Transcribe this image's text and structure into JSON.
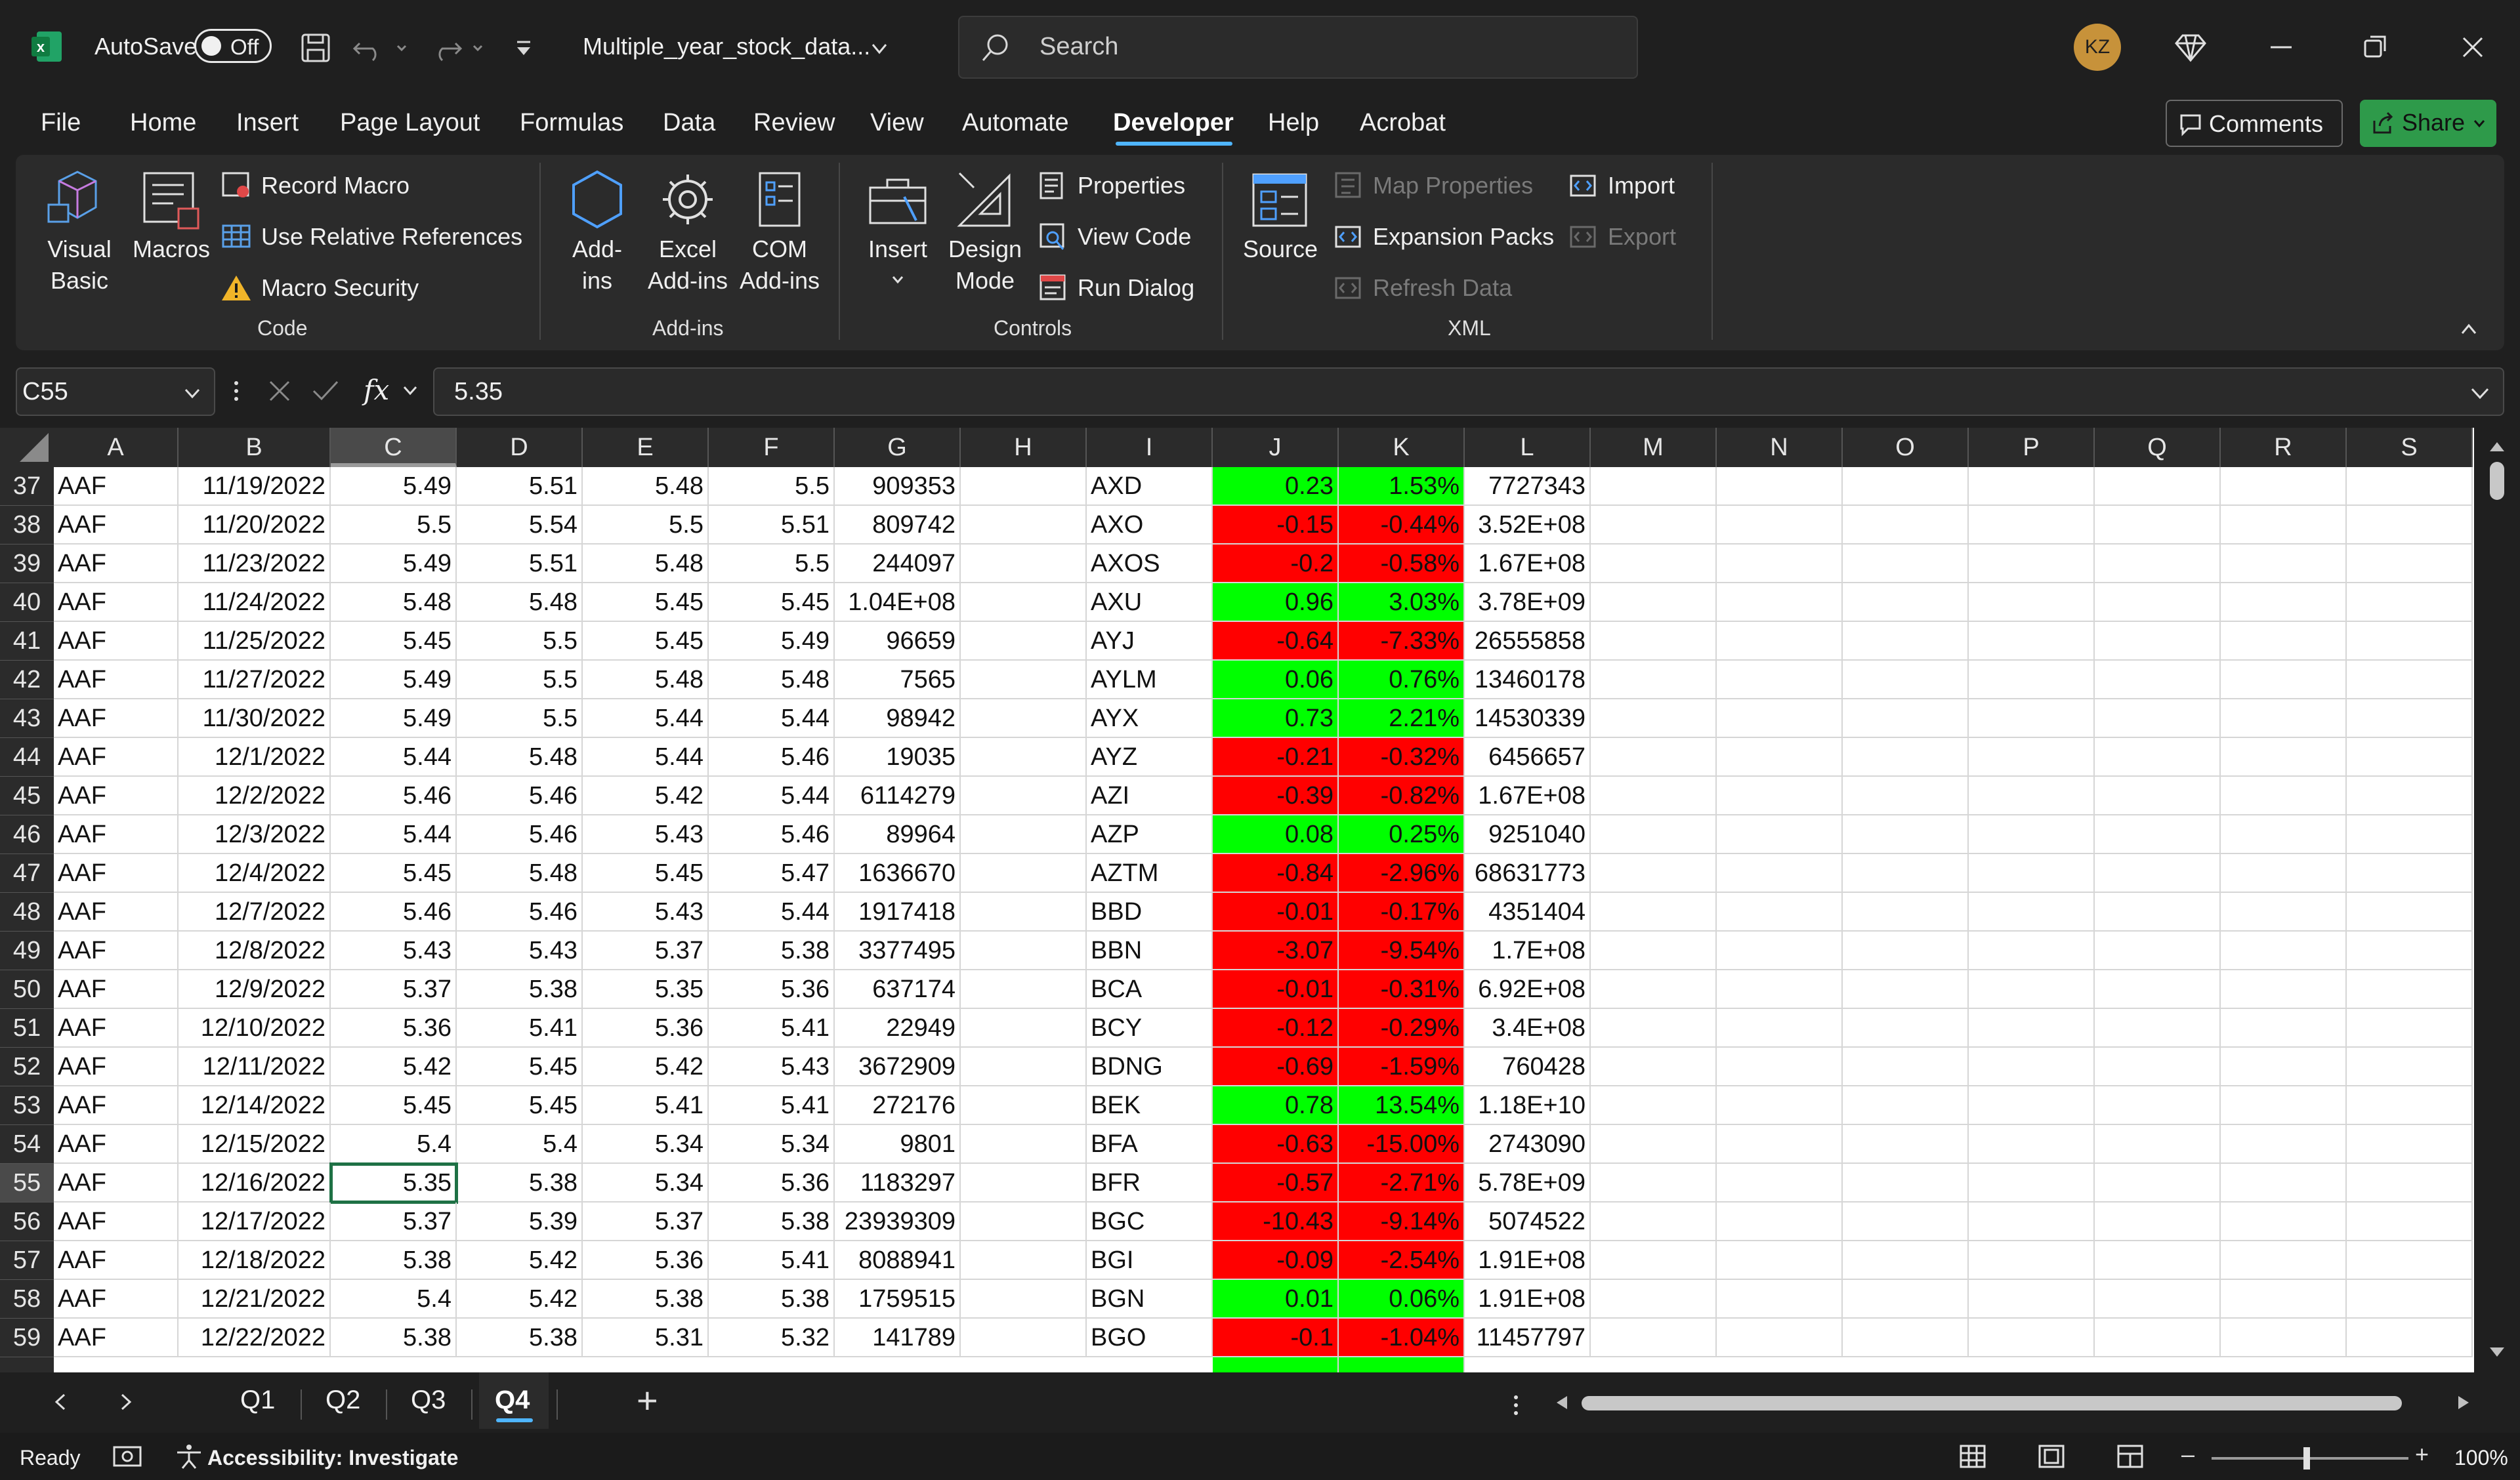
{
  "titlebar": {
    "autosave_label": "AutoSave",
    "autosave_state": "Off",
    "filename": "Multiple_year_stock_data...",
    "search_placeholder": "Search",
    "avatar_initials": "KZ"
  },
  "menu": {
    "tabs": [
      "File",
      "Home",
      "Insert",
      "Page Layout",
      "Formulas",
      "Data",
      "Review",
      "View",
      "Automate",
      "Developer",
      "Help",
      "Acrobat"
    ],
    "active": "Developer",
    "comments_label": "Comments",
    "share_label": "Share"
  },
  "ribbon": {
    "code": {
      "visual_basic": "Visual\nBasic",
      "macros": "Macros",
      "record_macro": "Record Macro",
      "use_relative": "Use Relative References",
      "macro_security": "Macro Security",
      "group": "Code"
    },
    "addins": {
      "addins": "Add-\nins",
      "excel_addins": "Excel\nAdd-ins",
      "com_addins": "COM\nAdd-ins",
      "group": "Add-ins"
    },
    "controls": {
      "insert": "Insert",
      "design_mode": "Design\nMode",
      "properties": "Properties",
      "view_code": "View Code",
      "run_dialog": "Run Dialog",
      "group": "Controls"
    },
    "xml": {
      "source": "Source",
      "map_properties": "Map Properties",
      "expansion_packs": "Expansion Packs",
      "refresh_data": "Refresh Data",
      "import": "Import",
      "export": "Export",
      "group": "XML"
    }
  },
  "formula_bar": {
    "name_box": "C55",
    "fx": "fx",
    "value": "5.35"
  },
  "grid": {
    "columns": [
      "A",
      "B",
      "C",
      "D",
      "E",
      "F",
      "G",
      "H",
      "I",
      "J",
      "K",
      "L",
      "M",
      "N",
      "O",
      "P",
      "Q",
      "R",
      "S"
    ],
    "selected_column": "C",
    "selected_row": "55",
    "rows": [
      {
        "n": "37",
        "a": "AAF",
        "b": "11/19/2022",
        "c": "5.49",
        "d": "5.51",
        "e": "5.48",
        "f": "5.5",
        "g": "909353",
        "i": "AXD",
        "j": "0.23",
        "k": "1.53%",
        "l": "7727343",
        "sign": "pos"
      },
      {
        "n": "38",
        "a": "AAF",
        "b": "11/20/2022",
        "c": "5.5",
        "d": "5.54",
        "e": "5.5",
        "f": "5.51",
        "g": "809742",
        "i": "AXO",
        "j": "-0.15",
        "k": "-0.44%",
        "l": "3.52E+08",
        "sign": "neg"
      },
      {
        "n": "39",
        "a": "AAF",
        "b": "11/23/2022",
        "c": "5.49",
        "d": "5.51",
        "e": "5.48",
        "f": "5.5",
        "g": "244097",
        "i": "AXOS",
        "j": "-0.2",
        "k": "-0.58%",
        "l": "1.67E+08",
        "sign": "neg"
      },
      {
        "n": "40",
        "a": "AAF",
        "b": "11/24/2022",
        "c": "5.48",
        "d": "5.48",
        "e": "5.45",
        "f": "5.45",
        "g": "1.04E+08",
        "i": "AXU",
        "j": "0.96",
        "k": "3.03%",
        "l": "3.78E+09",
        "sign": "pos"
      },
      {
        "n": "41",
        "a": "AAF",
        "b": "11/25/2022",
        "c": "5.45",
        "d": "5.5",
        "e": "5.45",
        "f": "5.49",
        "g": "96659",
        "i": "AYJ",
        "j": "-0.64",
        "k": "-7.33%",
        "l": "26555858",
        "sign": "neg"
      },
      {
        "n": "42",
        "a": "AAF",
        "b": "11/27/2022",
        "c": "5.49",
        "d": "5.5",
        "e": "5.48",
        "f": "5.48",
        "g": "7565",
        "i": "AYLM",
        "j": "0.06",
        "k": "0.76%",
        "l": "13460178",
        "sign": "pos"
      },
      {
        "n": "43",
        "a": "AAF",
        "b": "11/30/2022",
        "c": "5.49",
        "d": "5.5",
        "e": "5.44",
        "f": "5.44",
        "g": "98942",
        "i": "AYX",
        "j": "0.73",
        "k": "2.21%",
        "l": "14530339",
        "sign": "pos"
      },
      {
        "n": "44",
        "a": "AAF",
        "b": "12/1/2022",
        "c": "5.44",
        "d": "5.48",
        "e": "5.44",
        "f": "5.46",
        "g": "19035",
        "i": "AYZ",
        "j": "-0.21",
        "k": "-0.32%",
        "l": "6456657",
        "sign": "neg"
      },
      {
        "n": "45",
        "a": "AAF",
        "b": "12/2/2022",
        "c": "5.46",
        "d": "5.46",
        "e": "5.42",
        "f": "5.44",
        "g": "6114279",
        "i": "AZI",
        "j": "-0.39",
        "k": "-0.82%",
        "l": "1.67E+08",
        "sign": "neg"
      },
      {
        "n": "46",
        "a": "AAF",
        "b": "12/3/2022",
        "c": "5.44",
        "d": "5.46",
        "e": "5.43",
        "f": "5.46",
        "g": "89964",
        "i": "AZP",
        "j": "0.08",
        "k": "0.25%",
        "l": "9251040",
        "sign": "pos"
      },
      {
        "n": "47",
        "a": "AAF",
        "b": "12/4/2022",
        "c": "5.45",
        "d": "5.48",
        "e": "5.45",
        "f": "5.47",
        "g": "1636670",
        "i": "AZTM",
        "j": "-0.84",
        "k": "-2.96%",
        "l": "68631773",
        "sign": "neg"
      },
      {
        "n": "48",
        "a": "AAF",
        "b": "12/7/2022",
        "c": "5.46",
        "d": "5.46",
        "e": "5.43",
        "f": "5.44",
        "g": "1917418",
        "i": "BBD",
        "j": "-0.01",
        "k": "-0.17%",
        "l": "4351404",
        "sign": "neg"
      },
      {
        "n": "49",
        "a": "AAF",
        "b": "12/8/2022",
        "c": "5.43",
        "d": "5.43",
        "e": "5.37",
        "f": "5.38",
        "g": "3377495",
        "i": "BBN",
        "j": "-3.07",
        "k": "-9.54%",
        "l": "1.7E+08",
        "sign": "neg"
      },
      {
        "n": "50",
        "a": "AAF",
        "b": "12/9/2022",
        "c": "5.37",
        "d": "5.38",
        "e": "5.35",
        "f": "5.36",
        "g": "637174",
        "i": "BCA",
        "j": "-0.01",
        "k": "-0.31%",
        "l": "6.92E+08",
        "sign": "neg"
      },
      {
        "n": "51",
        "a": "AAF",
        "b": "12/10/2022",
        "c": "5.36",
        "d": "5.41",
        "e": "5.36",
        "f": "5.41",
        "g": "22949",
        "i": "BCY",
        "j": "-0.12",
        "k": "-0.29%",
        "l": "3.4E+08",
        "sign": "neg"
      },
      {
        "n": "52",
        "a": "AAF",
        "b": "12/11/2022",
        "c": "5.42",
        "d": "5.45",
        "e": "5.42",
        "f": "5.43",
        "g": "3672909",
        "i": "BDNG",
        "j": "-0.69",
        "k": "-1.59%",
        "l": "760428",
        "sign": "neg"
      },
      {
        "n": "53",
        "a": "AAF",
        "b": "12/14/2022",
        "c": "5.45",
        "d": "5.45",
        "e": "5.41",
        "f": "5.41",
        "g": "272176",
        "i": "BEK",
        "j": "0.78",
        "k": "13.54%",
        "l": "1.18E+10",
        "sign": "pos"
      },
      {
        "n": "54",
        "a": "AAF",
        "b": "12/15/2022",
        "c": "5.4",
        "d": "5.4",
        "e": "5.34",
        "f": "5.34",
        "g": "9801",
        "i": "BFA",
        "j": "-0.63",
        "k": "-15.00%",
        "l": "2743090",
        "sign": "neg"
      },
      {
        "n": "55",
        "a": "AAF",
        "b": "12/16/2022",
        "c": "5.35",
        "d": "5.38",
        "e": "5.34",
        "f": "5.36",
        "g": "1183297",
        "i": "BFR",
        "j": "-0.57",
        "k": "-2.71%",
        "l": "5.78E+09",
        "sign": "neg"
      },
      {
        "n": "56",
        "a": "AAF",
        "b": "12/17/2022",
        "c": "5.37",
        "d": "5.39",
        "e": "5.37",
        "f": "5.38",
        "g": "23939309",
        "i": "BGC",
        "j": "-10.43",
        "k": "-9.14%",
        "l": "5074522",
        "sign": "neg"
      },
      {
        "n": "57",
        "a": "AAF",
        "b": "12/18/2022",
        "c": "5.38",
        "d": "5.42",
        "e": "5.36",
        "f": "5.41",
        "g": "8088941",
        "i": "BGI",
        "j": "-0.09",
        "k": "-2.54%",
        "l": "1.91E+08",
        "sign": "neg"
      },
      {
        "n": "58",
        "a": "AAF",
        "b": "12/21/2022",
        "c": "5.4",
        "d": "5.42",
        "e": "5.38",
        "f": "5.38",
        "g": "1759515",
        "i": "BGN",
        "j": "0.01",
        "k": "0.06%",
        "l": "1.91E+08",
        "sign": "pos"
      },
      {
        "n": "59",
        "a": "AAF",
        "b": "12/22/2022",
        "c": "5.38",
        "d": "5.38",
        "e": "5.31",
        "f": "5.32",
        "g": "141789",
        "i": "BGO",
        "j": "-0.1",
        "k": "-1.04%",
        "l": "11457797",
        "sign": "neg"
      }
    ]
  },
  "sheets": {
    "tabs": [
      "Q1",
      "Q2",
      "Q3",
      "Q4"
    ],
    "active": "Q4",
    "add": "+"
  },
  "status": {
    "ready": "Ready",
    "accessibility": "Accessibility: Investigate",
    "zoom": "100%",
    "zoom_minus": "–",
    "zoom_plus": "+"
  },
  "colors": {
    "positive": "#00ff00",
    "negative": "#ff0000",
    "accent": "#4fb5ff",
    "share": "#2e9a4a",
    "selection": "#1e7145"
  }
}
